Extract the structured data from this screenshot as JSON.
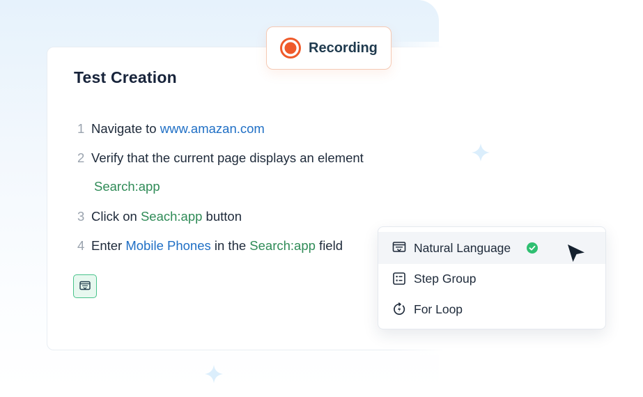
{
  "card": {
    "title": "Test Creation"
  },
  "steps": [
    {
      "num": "1",
      "parts": {
        "text1": "Navigate to ",
        "link": "www.amazan.com"
      }
    },
    {
      "num": "2",
      "parts": {
        "text1": "Verify that the current page displays an element",
        "element": "Search:app"
      }
    },
    {
      "num": "3",
      "parts": {
        "text1": "Click on ",
        "element": "Seach:app",
        "text2": " button"
      }
    },
    {
      "num": "4",
      "parts": {
        "text1": "Enter ",
        "value": "Mobile Phones",
        "text2": " in the ",
        "element": "Search:app",
        "text3": " field"
      }
    }
  ],
  "recording": {
    "label": "Recording",
    "accent": "#ef5a2a"
  },
  "menu": {
    "items": [
      {
        "label": "Natural Language",
        "icon": "natural-language-icon",
        "selected": true
      },
      {
        "label": "Step Group",
        "icon": "step-group-icon",
        "selected": false
      },
      {
        "label": "For Loop",
        "icon": "for-loop-icon",
        "selected": false
      }
    ]
  },
  "colors": {
    "link": "#1f6fc5",
    "element": "#2f8b57",
    "success": "#2fbf71",
    "title": "#17233a"
  }
}
